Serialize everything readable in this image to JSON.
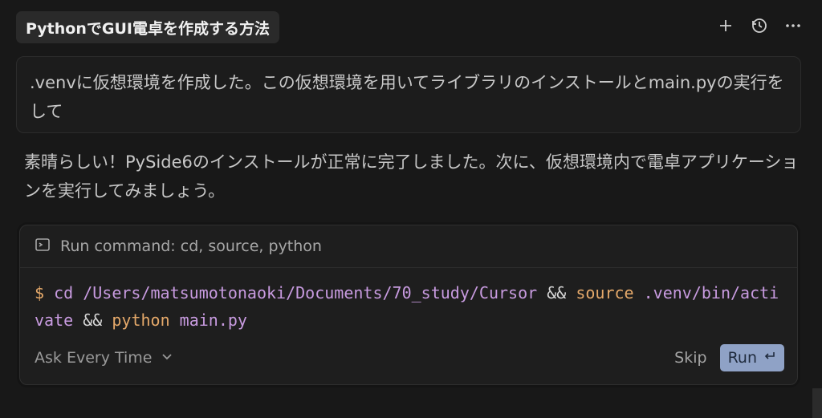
{
  "header": {
    "title": "PythonでGUI電卓を作成する方法",
    "icons": [
      "plus-icon",
      "history-icon",
      "more-icon"
    ]
  },
  "user_message": ".venvに仮想環境を作成した。この仮想環境を用いてライブラリのインストールとmain.pyの実行をして",
  "assistant_message": "素晴らしい！PySide6のインストールが正常に完了しました。次に、仮想環境内で電卓アプリケーションを実行してみましょう。",
  "command_card": {
    "header": "Run command: cd, source, python",
    "command": {
      "prompt": "$",
      "part1": "cd /Users/matsumotonaoki/Documents/70_study/Cursor",
      "op1": "&&",
      "kw1": "source",
      "part2": ".venv/bin/activate",
      "op2": "&&",
      "kw2": "python",
      "part3": "main.py"
    },
    "ask_label": "Ask Every Time",
    "skip_label": "Skip",
    "run_label": "Run"
  },
  "colors": {
    "background": "#181818",
    "accent": "#8fa2c6",
    "command_purple": "#c89be0",
    "command_orange": "#e5a96a"
  }
}
